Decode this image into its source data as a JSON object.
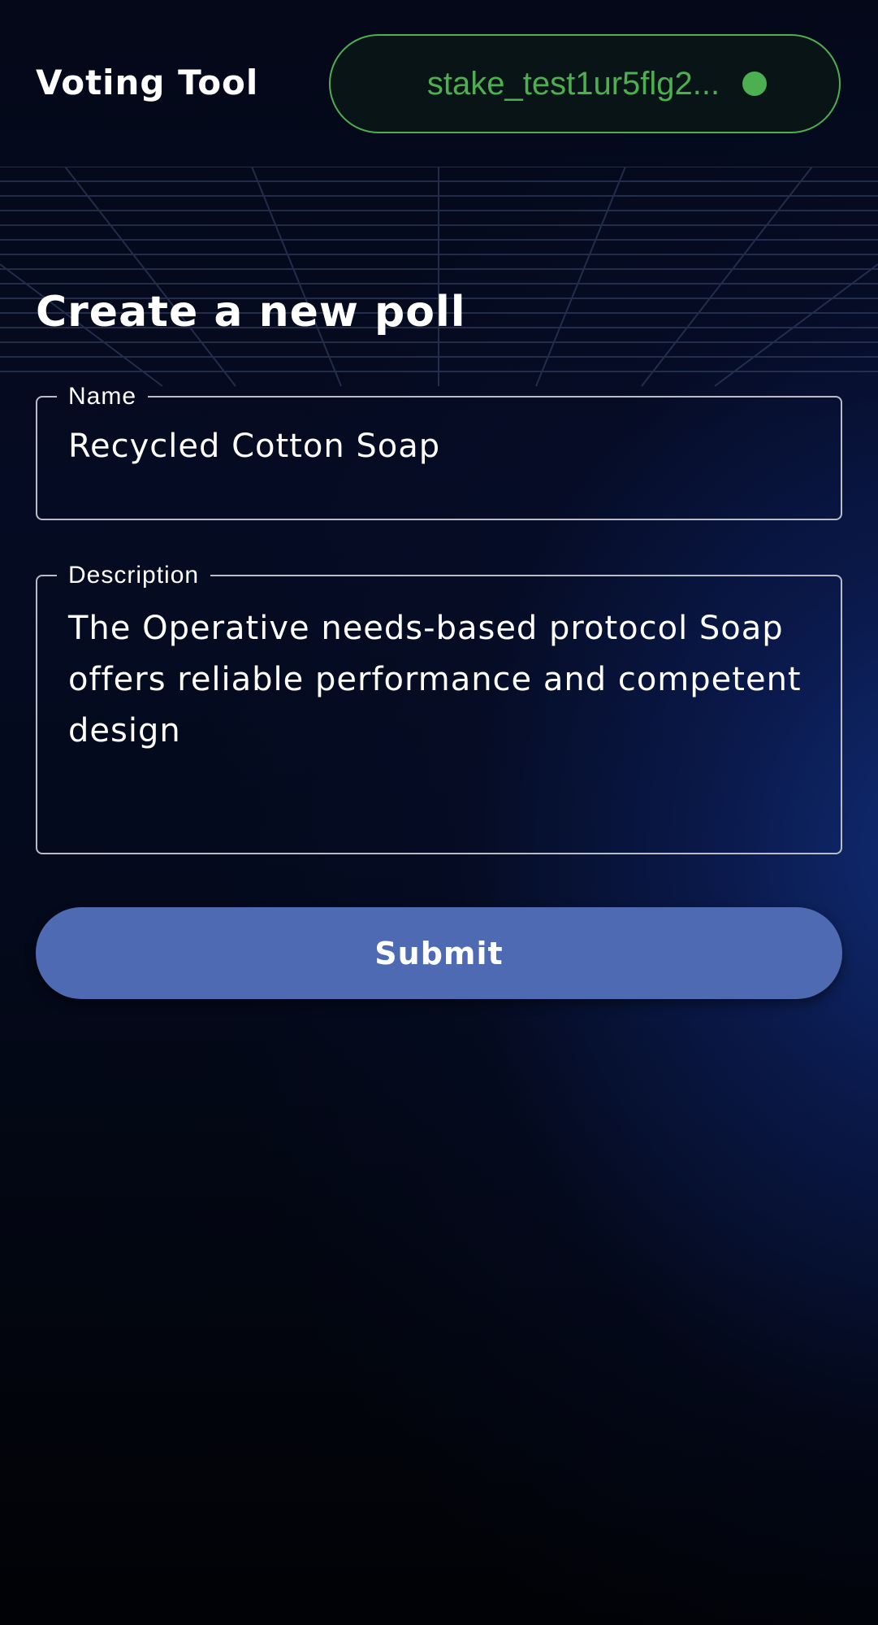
{
  "header": {
    "app_title": "Voting Tool",
    "wallet": {
      "address": "stake_test1ur5flg2...",
      "status": "connected",
      "status_color": "#4caf50"
    }
  },
  "form": {
    "title": "Create a new poll",
    "name": {
      "label": "Name",
      "value": "Recycled Cotton Soap"
    },
    "description": {
      "label": "Description",
      "value": "The Operative needs-based protocol Soap offers reliable performance and competent design"
    },
    "submit_label": "Submit"
  },
  "theme": {
    "accent": "#4e6ab3",
    "wallet_green": "#4caf50",
    "background": "#03050d"
  }
}
